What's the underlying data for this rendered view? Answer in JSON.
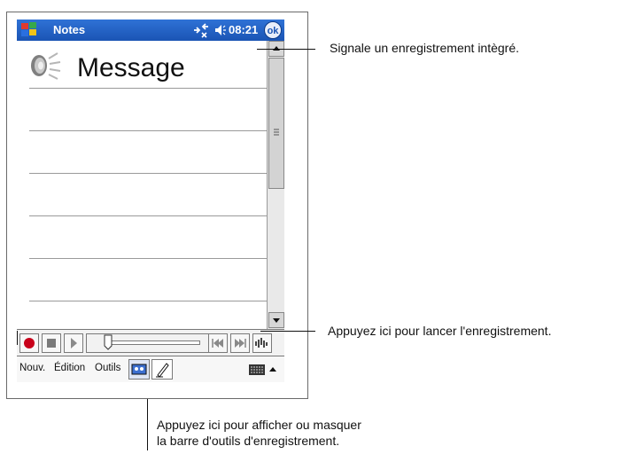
{
  "window": {
    "app_title": "Notes",
    "time": "08:21",
    "ok_label": "ok"
  },
  "note": {
    "message": "Message"
  },
  "menu": {
    "new": "Nouv.",
    "edit": "Édition",
    "tools": "Outils"
  },
  "annotations": {
    "embedded_recording": "Signale un enregistrement intègré.",
    "start_recording": "Appuyez ici pour lancer l'enregistrement.",
    "toggle_toolbar_line1": "Appuyez ici pour afficher ou masquer",
    "toggle_toolbar_line2": "la barre d'outils d'enregistrement."
  },
  "icons": {
    "start": "windows-flag-icon",
    "connectivity": "connectivity-icon",
    "volume": "speaker-volume-icon",
    "recording": "speaker-recording-icon",
    "record": "record-icon",
    "stop": "stop-icon",
    "play": "play-icon",
    "skip_back": "skip-back-icon",
    "skip_forward": "skip-forward-icon",
    "volume_level": "volume-level-icon",
    "toggle_recording_toolbar": "cassette-icon",
    "pen": "pen-icon",
    "keyboard": "keyboard-icon",
    "input_arrow": "up-arrow-icon"
  },
  "colors": {
    "titlebar": "#1c5dc2",
    "record": "#c8001a",
    "text": "#111111"
  }
}
